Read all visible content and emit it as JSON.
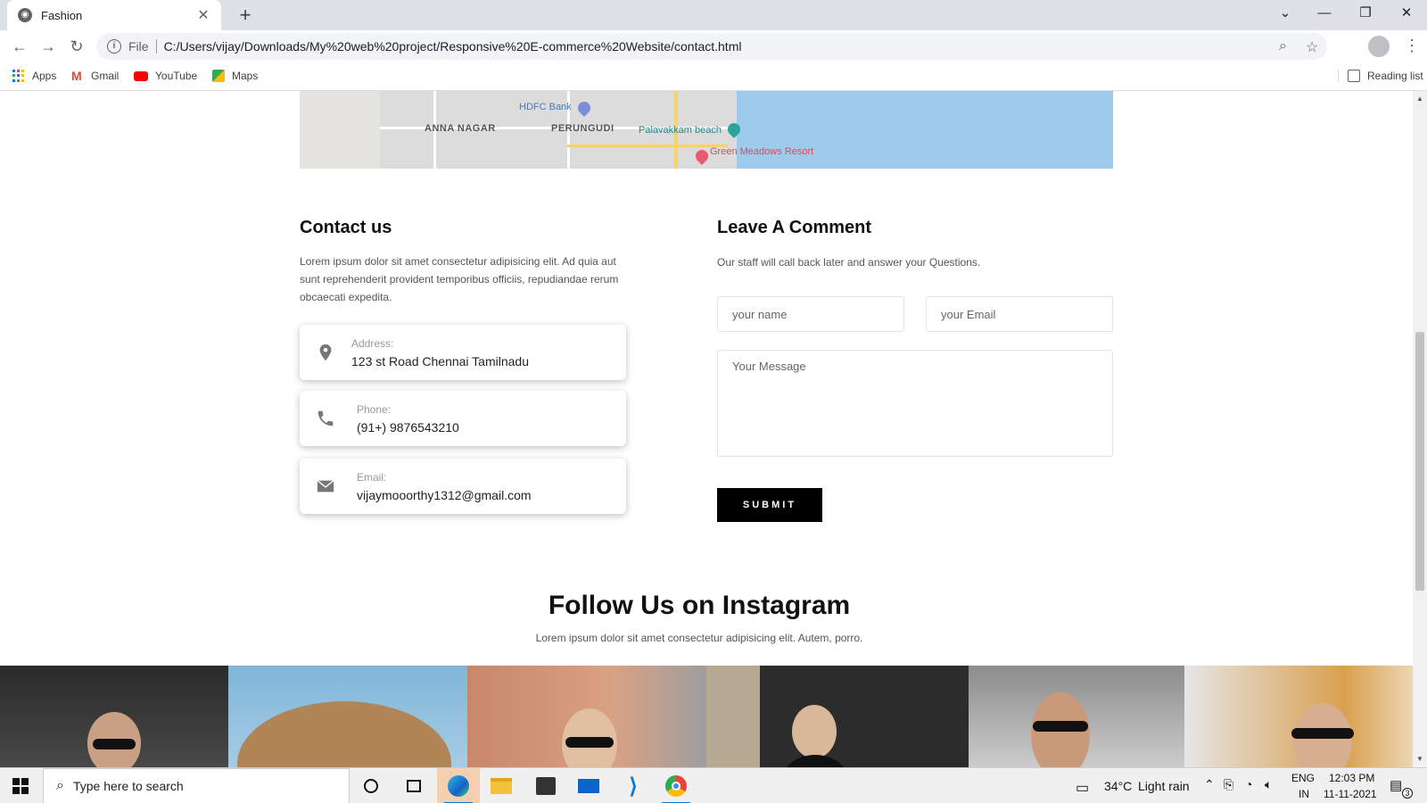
{
  "browser": {
    "tab_title": "Fashion",
    "url_scheme_label": "File",
    "url": "C:/Users/vijay/Downloads/My%20web%20project/Responsive%20E-commerce%20Website/contact.html",
    "bookmarks": [
      {
        "label": "Apps",
        "icon": "apps-grid-icon"
      },
      {
        "label": "Gmail",
        "icon": "gmail-icon"
      },
      {
        "label": "YouTube",
        "icon": "youtube-icon"
      },
      {
        "label": "Maps",
        "icon": "maps-icon"
      }
    ],
    "reading_list": "Reading list"
  },
  "map": {
    "labels": [
      "HDFC Bank",
      "ANNA NAGAR",
      "PERUNGUDI",
      "Palavakkam beach",
      "Green Meadows Resort"
    ]
  },
  "contact": {
    "title": "Contact us",
    "text": "Lorem ipsum dolor sit amet consectetur adipisicing elit. Ad quia aut sunt reprehenderit provident temporibus officiis, repudiandae rerum obcaecati expedita.",
    "cards": [
      {
        "label": "Address:",
        "value": "123 st Road Chennai Tamilnadu",
        "icon": "location-pin-icon"
      },
      {
        "label": "Phone:",
        "value": "(91+) 9876543210",
        "icon": "phone-icon"
      },
      {
        "label": "Email:",
        "value": "vijaymooorthy1312@gmail.com",
        "icon": "envelope-icon"
      }
    ]
  },
  "comment": {
    "title": "Leave A Comment",
    "text": "Our staff will call back later and answer your Questions.",
    "name_placeholder": "your name",
    "email_placeholder": "your Email",
    "message_placeholder": "Your Message",
    "submit_label": "SUBMIT"
  },
  "instagram": {
    "title": "Follow Us on Instagram",
    "subtitle": "Lorem ipsum dolor sit amet consectetur adipisicing elit. Autem, porro."
  },
  "taskbar": {
    "search_placeholder": "Type here to search",
    "weather_temp": "34°C",
    "weather_text": "Light rain",
    "lang_top": "ENG",
    "lang_bottom": "IN",
    "time": "12:03 PM",
    "date": "11-11-2021",
    "notification_count": "3"
  },
  "colors": {
    "submit_bg": "#000000",
    "sea": "#9ecbeb",
    "taskbar_active": "#f5d0b0"
  }
}
